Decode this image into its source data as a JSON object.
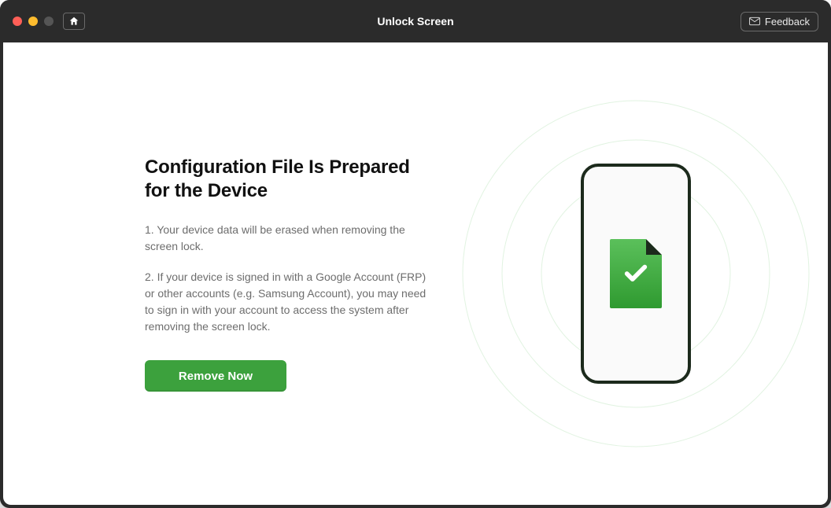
{
  "header": {
    "title": "Unlock Screen",
    "feedback_label": "Feedback"
  },
  "main": {
    "heading": "Configuration File Is Prepared for the Device",
    "paragraph1": "1. Your device data will be erased when removing the screen lock.",
    "paragraph2": "2. If your device is signed in with a Google Account (FRP) or other accounts (e.g. Samsung Account), you may need to sign in with your account to access the system after removing the screen lock.",
    "primary_button": "Remove Now"
  },
  "colors": {
    "accent": "#3ca13d",
    "titlebar": "#2b2b2b"
  }
}
